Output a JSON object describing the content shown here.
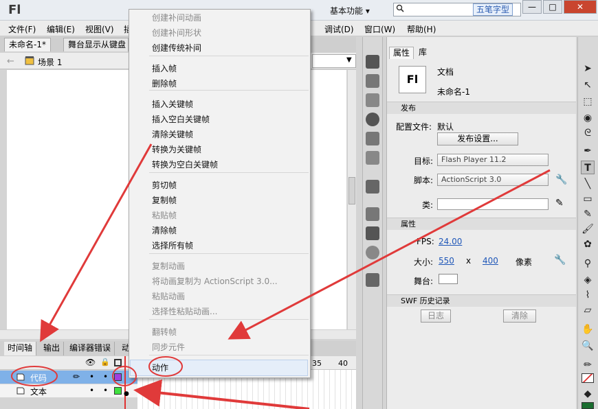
{
  "app": {
    "logo": "Fl",
    "workspace": "基本功能 ▾",
    "ime_text": "五笔字型"
  },
  "menu": [
    "文件(F)",
    "编辑(E)",
    "视图(V)",
    "插",
    "调试(D)",
    "窗口(W)",
    "帮助(H)"
  ],
  "doc_tabs": [
    "未命名-1*",
    "舞台显示从键盘"
  ],
  "scene": "场景 1",
  "timeline_tabs": [
    "时间轴",
    "输出",
    "编译器错误",
    "动"
  ],
  "timeline": {
    "ruler": [
      "35",
      "40"
    ],
    "layers": [
      {
        "name": "代码",
        "selected": true
      },
      {
        "name": "文本",
        "selected": false
      }
    ]
  },
  "context_menu": [
    {
      "label": "创建补间动画",
      "disabled": true
    },
    {
      "label": "创建补间形状",
      "disabled": true
    },
    {
      "label": "创建传统补间",
      "disabled": false
    },
    {
      "label": "插入帧",
      "disabled": false
    },
    {
      "label": "删除帧",
      "disabled": false
    },
    {
      "label": "插入关键帧",
      "disabled": false
    },
    {
      "label": "插入空白关键帧",
      "disabled": false
    },
    {
      "label": "清除关键帧",
      "disabled": false
    },
    {
      "label": "转换为关键帧",
      "disabled": false
    },
    {
      "label": "转换为空白关键帧",
      "disabled": false
    },
    {
      "label": "剪切帧",
      "disabled": false
    },
    {
      "label": "复制帧",
      "disabled": false
    },
    {
      "label": "粘贴帧",
      "disabled": true
    },
    {
      "label": "清除帧",
      "disabled": false
    },
    {
      "label": "选择所有帧",
      "disabled": false
    },
    {
      "label": "复制动画",
      "disabled": true
    },
    {
      "label": "将动画复制为 ActionScript 3.0...",
      "disabled": true
    },
    {
      "label": "粘贴动画",
      "disabled": true
    },
    {
      "label": "选择性粘贴动画...",
      "disabled": true
    },
    {
      "label": "翻转帧",
      "disabled": true
    },
    {
      "label": "同步元件",
      "disabled": true
    },
    {
      "label": "动作",
      "disabled": false,
      "highlighted": true
    }
  ],
  "props": {
    "tabs": [
      "属性",
      "库"
    ],
    "doc_icon": "Fl",
    "doc_type": "文档",
    "doc_name": "未命名-1",
    "publish": {
      "section": "发布",
      "profile_label": "配置文件:",
      "profile_value": "默认",
      "settings_button": "发布设置...",
      "target_label": "目标:",
      "target_value": "Flash Player 11.2",
      "script_label": "脚本:",
      "script_value": "ActionScript 3.0",
      "class_label": "类:"
    },
    "properties": {
      "section": "属性",
      "fps_label": "FPS:",
      "fps_value": "24.00",
      "size_label": "大小:",
      "width": "550",
      "x": "x",
      "height": "400",
      "unit": "像素",
      "stage_label": "舞台:",
      "stage_color": "#ffffff"
    },
    "swf_history": {
      "section": "SWF 历史记录",
      "log_button": "日志",
      "clear_button": "清除"
    }
  },
  "colors": {
    "annotation": "#e03a3a",
    "selected_layer": "#7fb1e8",
    "menu_bg": "#f2f2f2"
  }
}
